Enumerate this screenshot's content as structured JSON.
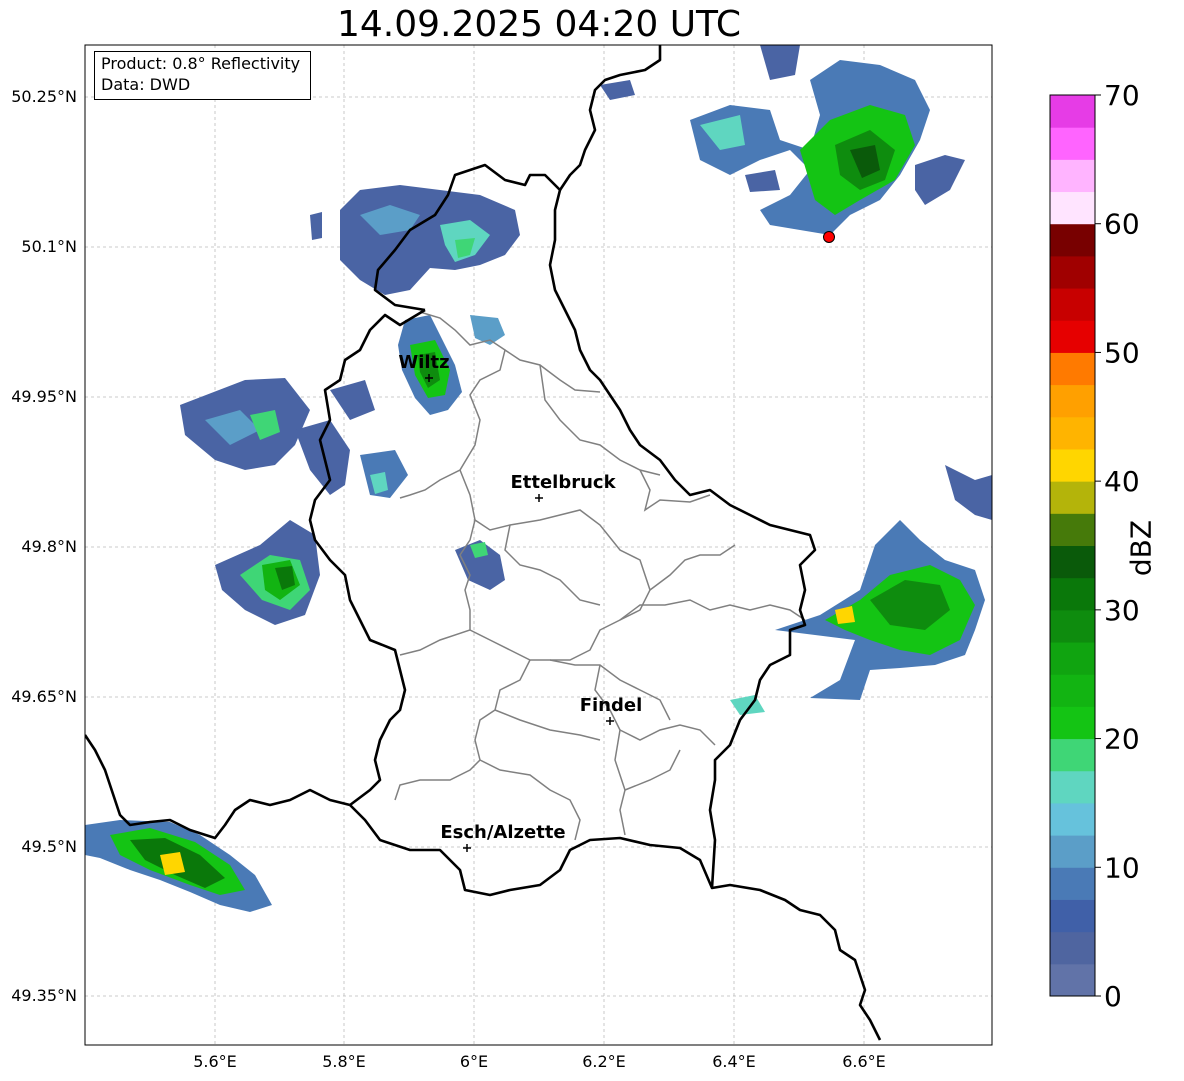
{
  "title": "14.09.2025 04:20 UTC",
  "info": {
    "product": "Product: 0.8° Reflectivity",
    "data": "Data: DWD"
  },
  "map": {
    "lon_ticks": [
      "5.6°E",
      "5.8°E",
      "6°E",
      "6.2°E",
      "6.4°E",
      "6.6°E"
    ],
    "lat_ticks": [
      "50.25°N",
      "50.1°N",
      "49.95°N",
      "49.8°N",
      "49.65°N",
      "49.5°N",
      "49.35°N"
    ],
    "cities": [
      {
        "name": "Wiltz",
        "icon": "plus-marker-icon"
      },
      {
        "name": "Ettelbruck",
        "icon": "plus-marker-icon"
      },
      {
        "name": "Findel",
        "icon": "plus-marker-icon"
      },
      {
        "name": "Esch/Alzette",
        "icon": "plus-marker-icon"
      }
    ],
    "radar_site_icon": "red-dot-icon"
  },
  "colorbar": {
    "label": "dBZ",
    "ticks": [
      "0",
      "10",
      "20",
      "30",
      "40",
      "50",
      "60",
      "70"
    ],
    "colors": [
      "#6173a8",
      "#4f65a0",
      "#4060a8",
      "#4a7ab6",
      "#5b9ec8",
      "#66c2dc",
      "#5fd6c0",
      "#3fd676",
      "#14c414",
      "#12b412",
      "#10a410",
      "#0e8c0e",
      "#0a780a",
      "#0a5a0a",
      "#467a0a",
      "#b4b40a",
      "#ffd600",
      "#ffb400",
      "#ffa000",
      "#ff7a00",
      "#e60000",
      "#c80000",
      "#a00000",
      "#780000",
      "#ffe4ff",
      "#ffb4ff",
      "#ff64ff",
      "#e63ce6"
    ]
  }
}
